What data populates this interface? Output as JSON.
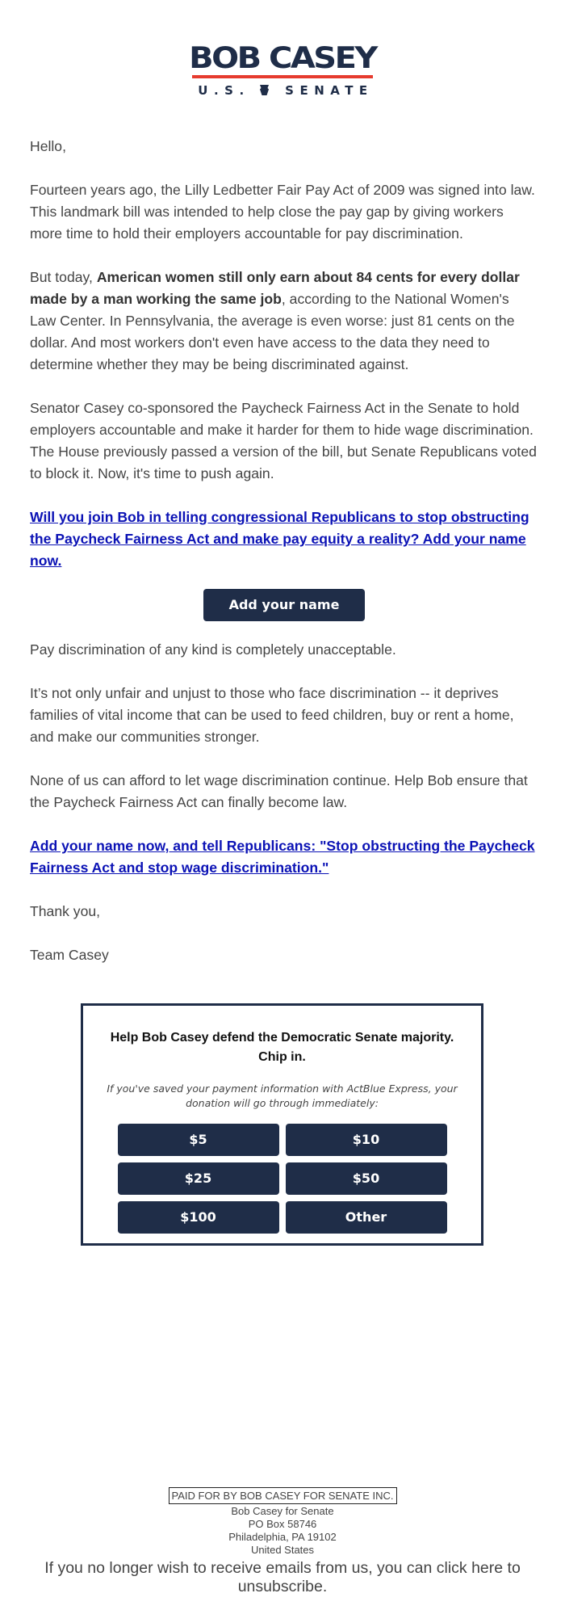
{
  "logo": {
    "name": "BOB CASEY",
    "sub_left": "U.S.",
    "sub_right": "SENATE",
    "emblem_icon": "keystone-icon",
    "accent_color": "#e63b2e",
    "brand_color": "#1f2d48"
  },
  "email": {
    "greeting": "Hello,",
    "para1": "Fourteen years ago, the Lilly Ledbetter Fair Pay Act of 2009 was signed into law. This landmark bill was intended to help close the pay gap by giving workers more time to hold their employers accountable for pay discrimination.",
    "para2_prefix": "But today, ",
    "para2_bold": "American women still only earn about 84 cents for every dollar made by a man working the same job",
    "para2_suffix": ", according to the National Women's Law Center. In Pennsylvania, the average is even worse: just 81 cents on the dollar. And most workers don't even have access to the data they need to determine whether they may be being discriminated against.",
    "para3": "Senator Casey co-sponsored the Paycheck Fairness Act in the Senate to hold employers accountable and make it harder for them to hide wage discrimination. The House previously passed a version of the bill, but Senate Republicans voted to block it. Now, it's time to push again.",
    "link1": "Will you join Bob in telling congressional Republicans to stop obstructing the Paycheck Fairness Act and make pay equity a reality? Add your name now.",
    "cta_button": "Add your name",
    "para4": "Pay discrimination of any kind is completely unacceptable.",
    "para5": "It’s not only unfair and unjust to those who face discrimination -- it deprives families of vital income that can be used to feed children, buy or rent a home, and make our communities stronger.",
    "para6": "None of us can afford to let wage discrimination continue. Help Bob ensure that the Paycheck Fairness Act can finally become law.",
    "link2": "Add your name now, and tell Republicans: \"Stop obstructing the Paycheck Fairness Act and stop wage discrimination.\"",
    "signoff": "Thank you,",
    "signature": "Team Casey"
  },
  "donate": {
    "title": "Help Bob Casey defend the Democratic Senate majority. Chip in.",
    "note": "If you've saved your payment information with ActBlue Express, your donation will go through immediately:",
    "amounts": [
      "$5",
      "$10",
      "$25",
      "$50",
      "$100",
      "Other"
    ]
  },
  "footer": {
    "paid_for": "PAID FOR BY BOB CASEY FOR SENATE INC.",
    "address": [
      "Bob Casey for Senate",
      "PO Box 58746",
      "Philadelphia, PA 19102",
      "United States"
    ],
    "unsubscribe": "If you no longer wish to receive emails from us, you can click here to unsubscribe."
  }
}
